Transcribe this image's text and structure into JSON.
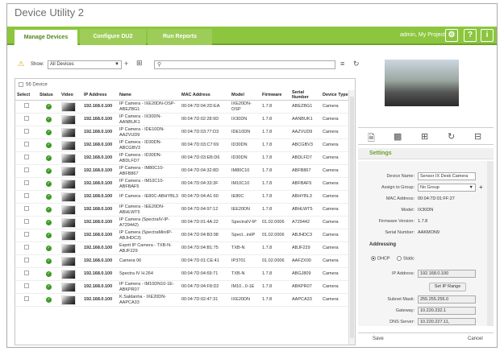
{
  "app": {
    "title": "Device Utility 2"
  },
  "tabs": [
    {
      "label": "Manage Devices"
    },
    {
      "label": "Configure DU2"
    },
    {
      "label": "Run Reports"
    }
  ],
  "header": {
    "user": "admin, My Project",
    "icons": [
      "settings-icon",
      "help-icon",
      "info-icon"
    ]
  },
  "toolbar": {
    "show_label": "Show:",
    "filter_value": "All Devices",
    "search_placeholder": ""
  },
  "device_list": {
    "count_label": "56 Device",
    "columns": [
      "Select",
      "Status",
      "Video",
      "IP Address",
      "Name",
      "MAC Address",
      "Model",
      "Firmware",
      "Serial Number",
      "Device Type"
    ],
    "rows": [
      {
        "ip": "192.168.0.100",
        "name": "IP Camera - IXE20DN-OSP-ABEZBG1",
        "mac": "00:04:7D:04:2D:EA",
        "model": "IXE20DN-OSP",
        "firmware": "1.7.8",
        "serial": "ABEZBG1",
        "type": "Camera"
      },
      {
        "ip": "192.168.0.100",
        "name": "IP Camera - IX30DN-AANBUK1",
        "mac": "00:04:7D:02:28:9D",
        "model": "IX30DN",
        "firmware": "1.7.8",
        "serial": "AANBUK1",
        "type": "Camera"
      },
      {
        "ip": "192.168.0.100",
        "name": "IP Camera - IDE10DN-AAZVUD9",
        "mac": "00:04:7D:03:77:D3",
        "model": "IDE10DN",
        "firmware": "1.7.8",
        "serial": "AAZVUD9",
        "type": "Camera"
      },
      {
        "ip": "192.168.0.100",
        "name": "IP Camera - ID30DN-ABCGBV3",
        "mac": "00:04:7D:03:C7:69",
        "model": "ID30DN",
        "firmware": "1.7.8",
        "serial": "ABCGBV3",
        "type": "Camera"
      },
      {
        "ip": "192.168.0.100",
        "name": "IP Camera - ID30DN-ABDLFD7",
        "mac": "00:04:7D:03:EB:D6",
        "model": "ID30DN",
        "firmware": "1.7.8",
        "serial": "ABDLFD7",
        "type": "Camera"
      },
      {
        "ip": "192.168.0.100",
        "name": "IP Camera - IM80C10-ABFB867",
        "mac": "00:04:7D:04:32:8D",
        "model": "IM80C10",
        "firmware": "1.7.8",
        "serial": "ABFB867",
        "type": "Camera"
      },
      {
        "ip": "192.168.0.100",
        "name": "IP Camera - IM10C10-ABFBAF5",
        "mac": "00:04:7D:04:33:3F",
        "model": "IM10C10",
        "firmware": "1.7.8",
        "serial": "ABFBAF5",
        "type": "Camera"
      },
      {
        "ip": "192.168.0.100",
        "name": "IP Camera - IE80C-ABHYBL3",
        "mac": "00:04:7D:04:A1:60",
        "model": "IE80C",
        "firmware": "1.7.8",
        "serial": "ABHYBL3",
        "type": "Camera"
      },
      {
        "ip": "192.168.0.100",
        "name": "IP Camera - IEE20DN-ABHLWT5",
        "mac": "00:04:7D:04:97:12",
        "model": "IEE20DN",
        "firmware": "1.7.8",
        "serial": "ABHLWT5",
        "type": "Camera"
      },
      {
        "ip": "192.168.0.100",
        "name": "IP Camera (SpectraIV-IP-A729442)",
        "mac": "00:04:7D:01:4A:22",
        "model": "SpectraIV-IP",
        "firmware": "01.02.0006",
        "serial": "A729442",
        "type": "Camera"
      },
      {
        "ip": "192.168.0.100",
        "name": "IP Camera (SpectraMiniIP-ABJHDC3)",
        "mac": "00:04:7D:04:B3:98",
        "model": "Spect...iniIP",
        "firmware": "01.02.0006",
        "serial": "ABJHDC3",
        "type": "Camera"
      },
      {
        "ip": "192.168.0.100",
        "name": "Esprit IP Camera - TXB-N-ABJF229",
        "mac": "00:04:7D:04:B1:75",
        "model": "TXB-N",
        "firmware": "1.7.8",
        "serial": "ABJF229",
        "type": "Camera"
      },
      {
        "ip": "192.168.0.100",
        "name": "Camera 06",
        "mac": "00:04:7D:01:CE:41",
        "model": "IP3701",
        "firmware": "01.02.0006",
        "serial": "AAFZX00",
        "type": "Camera"
      },
      {
        "ip": "192.168.0.100",
        "name": "Spectra IV H.264",
        "mac": "00:04:7D:04:69:71",
        "model": "TXB-N",
        "firmware": "1.7.8",
        "serial": "ABGJ809",
        "type": "Camera"
      },
      {
        "ip": "192.168.0.100",
        "name": "IP Camera - IM10DN10-1E-ABKPR07",
        "mac": "00:04:7D:04:F8:D2",
        "model": "IM10...0-1E",
        "firmware": "1.7.8",
        "serial": "ABKPR07",
        "type": "Camera"
      },
      {
        "ip": "192.168.0.100",
        "name": "K.Saldanha - IXE20DN-AAPCA33",
        "mac": "00:04:7D:02:47:31",
        "model": "IXE20DN",
        "firmware": "1.7.8",
        "serial": "AAPCA33",
        "type": "Camera"
      }
    ]
  },
  "settings": {
    "title": "Settings",
    "device_name_label": "Device Name:",
    "device_name_value": "Sensor IX Desk Camera",
    "assign_group_label": "Assign to Group:",
    "assign_group_value": "No Group",
    "mac_label": "MAC Address:",
    "mac_value": "00:04:7D:01:FF:27",
    "model_label": "Model:",
    "model_value": "IX30DN",
    "firmware_label": "Firmware Version:",
    "firmware_value": "1.7.8",
    "serial_label": "Serial Number:",
    "serial_value": "AAKMON9",
    "addressing_label": "Addressing",
    "dhcp_label": "DHCP",
    "static_label": "Static",
    "ip_label": "IP Address:",
    "ip_value": "192.168.0.100",
    "set_ip_range": "Set IP Range",
    "subnet_label": "Subnet Mask:",
    "subnet_value": "255.255.255.0",
    "gateway_label": "Gateway:",
    "gateway_value": "10.220.232.1",
    "dns_label": "DNS Server:",
    "dns_value": "10.220.227.11,",
    "save": "Save",
    "cancel": "Cancel"
  }
}
